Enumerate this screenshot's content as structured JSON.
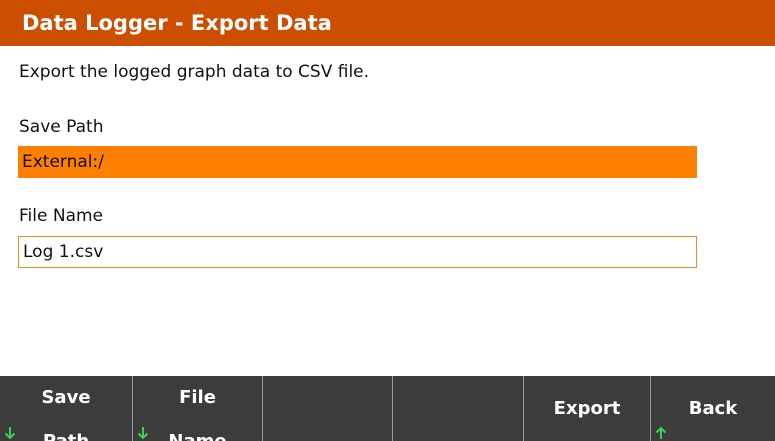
{
  "title": "Data Logger - Export Data",
  "description": "Export the logged graph data to CSV file.",
  "save_path": {
    "label": "Save Path",
    "value": "External:/"
  },
  "file_name": {
    "label": "File Name",
    "value": "Log 1.csv"
  },
  "softkeys": [
    {
      "line1": "Save",
      "line2": "Path",
      "icon": "arrow-down-icon"
    },
    {
      "line1": "File",
      "line2": "Name",
      "icon": "arrow-down-icon"
    },
    {
      "line1": "",
      "line2": "",
      "icon": ""
    },
    {
      "line1": "",
      "line2": "",
      "icon": ""
    },
    {
      "line1": "Export",
      "line2": "",
      "icon": ""
    },
    {
      "line1": "Back",
      "line2": "",
      "icon": "arrow-up-icon"
    }
  ],
  "colors": {
    "title_bar": "#cc4e00",
    "selected_field": "#ff7f00",
    "softkey_bar": "#3c3c3c",
    "arrow": "#39d353"
  }
}
